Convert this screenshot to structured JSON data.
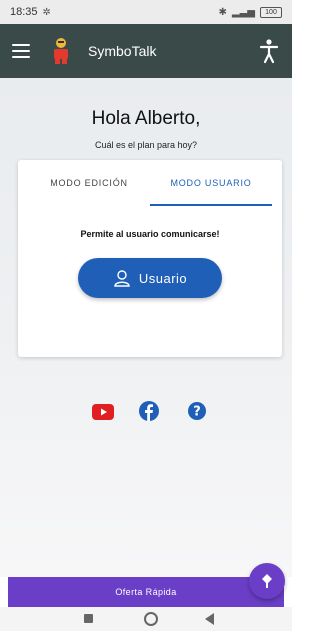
{
  "status_bar": {
    "time": "18:35",
    "battery": "100"
  },
  "app_bar": {
    "title": "SymboTalk"
  },
  "main": {
    "greeting": "Hola Alberto,",
    "subtitle": "Cuál es el plan para hoy?"
  },
  "card": {
    "tabs": [
      {
        "label": "MODO EDICIÓN",
        "selected": false
      },
      {
        "label": "MODO USUARIO",
        "selected": true
      }
    ],
    "description": "Permite al usuario comunicarse!",
    "user_button_label": "Usuario"
  },
  "social": [
    "youtube-icon",
    "facebook-icon",
    "help-icon"
  ],
  "bottom_bar": {
    "label": "Oferta Rápida"
  },
  "colors": {
    "app_bar": "#3a4a48",
    "accent_blue": "#1f5fb8",
    "offer_purple": "#6a3ec6",
    "youtube_red": "#e02020",
    "facebook_blue": "#1f5fb8"
  }
}
